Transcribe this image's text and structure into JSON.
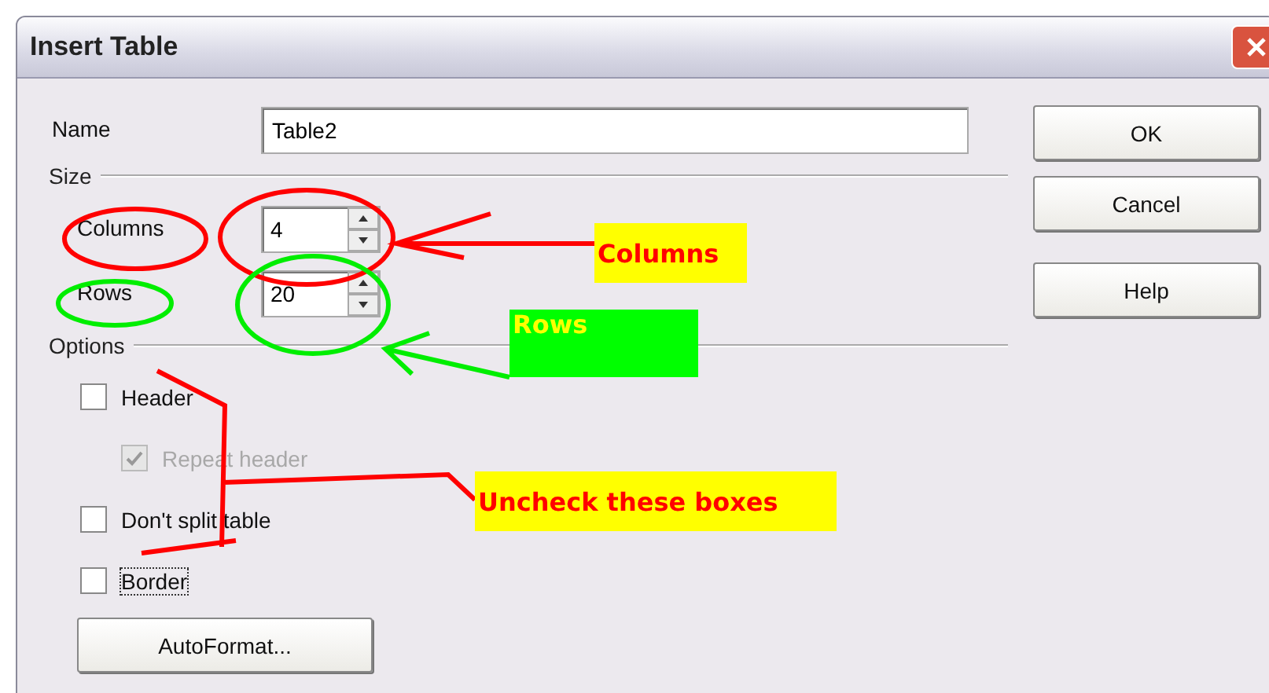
{
  "window": {
    "title": "Insert Table"
  },
  "name_field": {
    "label": "Name",
    "value": "Table2"
  },
  "size": {
    "heading": "Size",
    "columns": {
      "label": "Columns",
      "value": "4"
    },
    "rows": {
      "label": "Rows",
      "value": "20"
    }
  },
  "options": {
    "heading": "Options",
    "items": [
      {
        "label": "Header",
        "checked": false,
        "disabled": false,
        "indented": false,
        "focused": false
      },
      {
        "label": "Repeat header",
        "checked": true,
        "disabled": true,
        "indented": true,
        "focused": false
      },
      {
        "label": "Don't split table",
        "checked": false,
        "disabled": false,
        "indented": false,
        "focused": false
      },
      {
        "label": "Border",
        "checked": false,
        "disabled": false,
        "indented": false,
        "focused": true
      }
    ],
    "autoformat": "AutoFormat..."
  },
  "buttons": [
    "OK",
    "Cancel",
    "Help"
  ],
  "annotations": [
    {
      "text": "Columns",
      "color": "#ffff00"
    },
    {
      "text": "Rows",
      "color": "#00ff00"
    },
    {
      "text": "Uncheck these boxes",
      "color": "#ffff00"
    }
  ]
}
